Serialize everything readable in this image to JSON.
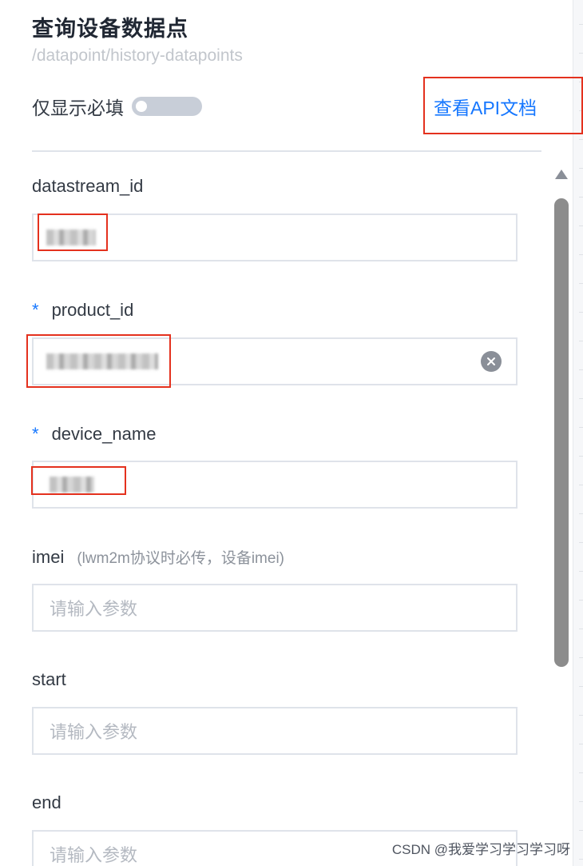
{
  "header": {
    "title": "查询设备数据点",
    "path": "/datapoint/history-datapoints",
    "required_only_label": "仅显示必填",
    "required_only_enabled": false,
    "api_doc_link": "查看API文档"
  },
  "fields": [
    {
      "label": "datastream_id",
      "required": false,
      "required_mark": "",
      "hint": "",
      "placeholder": "",
      "value_obscured": true
    },
    {
      "label": "product_id",
      "required": true,
      "required_mark": "*",
      "hint": "",
      "placeholder": "",
      "value_obscured": true,
      "clearable": true
    },
    {
      "label": "device_name",
      "required": true,
      "required_mark": "*",
      "hint": "",
      "placeholder": "",
      "value_obscured": true
    },
    {
      "label": "imei",
      "required": false,
      "required_mark": "",
      "hint": "(lwm2m协议时必传，设备imei)",
      "placeholder": "请输入参数"
    },
    {
      "label": "start",
      "required": false,
      "required_mark": "",
      "hint": "",
      "placeholder": "请输入参数"
    },
    {
      "label": "end",
      "required": false,
      "required_mark": "",
      "hint": "",
      "placeholder": "请输入参数"
    }
  ],
  "watermark": "CSDN @我爱学习学习学习呀",
  "colors": {
    "accent": "#1677ff",
    "annotation_red": "#e4311e",
    "title": "#202733",
    "toggle_off": "#c8ced8"
  },
  "icons": [
    "clear-icon",
    "scroll-up-icon"
  ]
}
